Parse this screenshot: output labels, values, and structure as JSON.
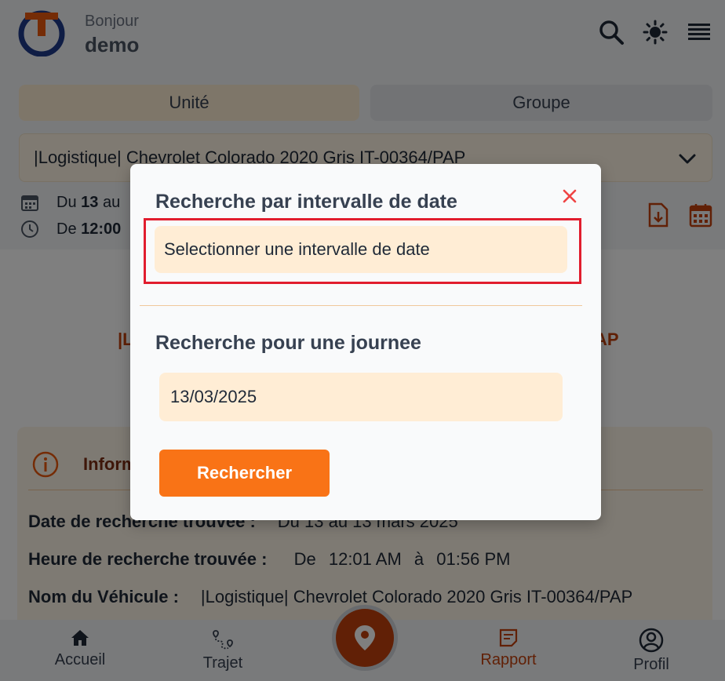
{
  "header": {
    "greeting": "Bonjour",
    "username": "demo"
  },
  "tabs": [
    {
      "label": "Unité"
    },
    {
      "label": "Groupe"
    }
  ],
  "vehicle_select": {
    "value": "|Logistique| Chevrolet Colorado 2020 Gris IT-00364/PAP"
  },
  "date_line": {
    "du": "Du",
    "day": "13",
    "au": "au"
  },
  "time_line": {
    "de": "De",
    "time": "12:00"
  },
  "vehicle_title_left": "|L",
  "vehicle_title_right": "AP",
  "info_card": {
    "title": "Inform",
    "rows": [
      {
        "label": "Date de recherche trouvée :",
        "value": "Du 13 au 13 mars 2025"
      },
      {
        "label": "Heure de recherche trouvée :",
        "de": "De",
        "start": "12:01 AM",
        "a": "à",
        "end": "01:56 PM"
      },
      {
        "label": "Nom du Véhicule :",
        "value": "|Logistique| Chevrolet Colorado 2020 Gris IT-00364/PAP"
      }
    ]
  },
  "nav": [
    {
      "label": "Accueil"
    },
    {
      "label": "Trajet"
    },
    {
      "label": "Rapport"
    },
    {
      "label": "Profil"
    }
  ],
  "modal": {
    "range_title": "Recherche par intervalle de date",
    "range_placeholder": "Selectionner une intervalle de date",
    "day_title": "Recherche pour une journee",
    "day_value": "13/03/2025",
    "search_label": "Rechercher"
  },
  "colors": {
    "accent": "#f97316",
    "brand_dark": "#c2410c",
    "highlight_frame": "#e11d2e",
    "input_bg": "#ffedd5"
  }
}
